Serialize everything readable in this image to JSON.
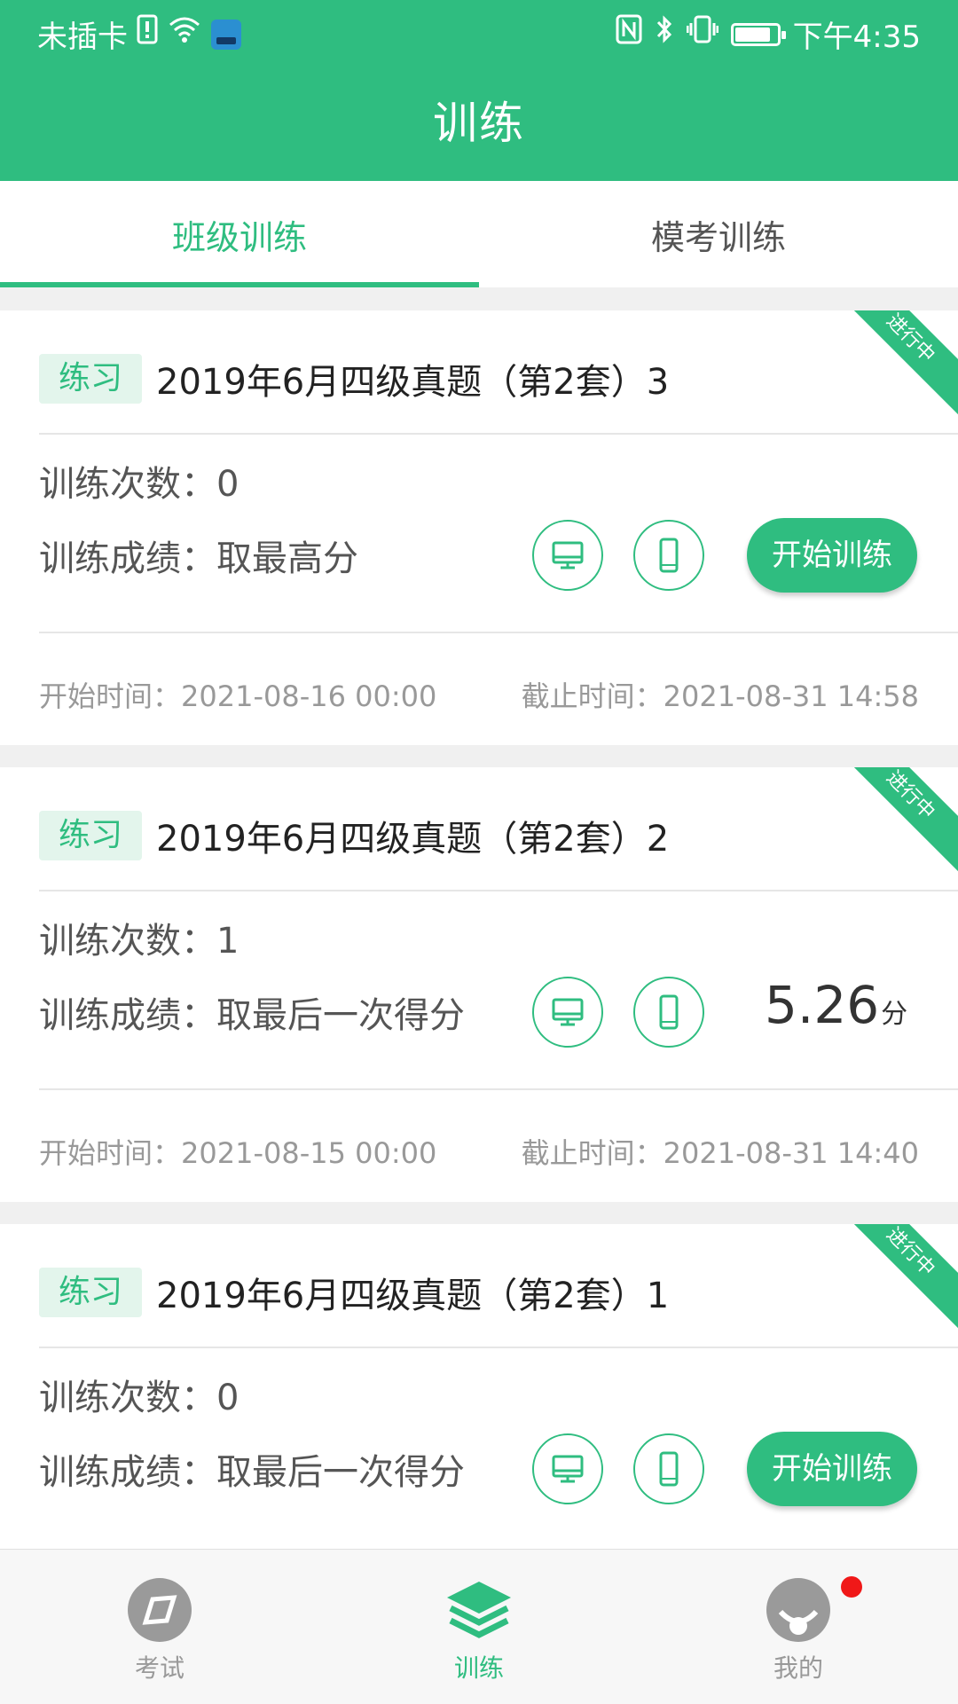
{
  "status_bar": {
    "carrier": "未插卡",
    "time": "下午4:35",
    "battery_level": 0.85
  },
  "header": {
    "title": "训练"
  },
  "tabs": [
    {
      "label": "班级训练",
      "active": true
    },
    {
      "label": "模考训练",
      "active": false
    }
  ],
  "cards": [
    {
      "badge": "进行中",
      "tag": "练习",
      "title": "2019年6月四级真题（第2套）3",
      "count_label": "训练次数：",
      "count": "0",
      "score_label": "训练成绩：",
      "score_rule": "取最高分",
      "action": "开始训练",
      "start_label": "开始时间：",
      "start_time": "2021-08-16 00:00",
      "end_label": "截止时间：",
      "end_time": "2021-08-31 14:58"
    },
    {
      "badge": "进行中",
      "tag": "练习",
      "title": "2019年6月四级真题（第2套）2",
      "count_label": "训练次数：",
      "count": "1",
      "score_label": "训练成绩：",
      "score_rule": "取最后一次得分",
      "score_value": "5.26",
      "score_unit": "分",
      "start_label": "开始时间：",
      "start_time": "2021-08-15 00:00",
      "end_label": "截止时间：",
      "end_time": "2021-08-31 14:40"
    },
    {
      "badge": "进行中",
      "tag": "练习",
      "title": "2019年6月四级真题（第2套）1",
      "count_label": "训练次数：",
      "count": "0",
      "score_label": "训练成绩：",
      "score_rule": "取最后一次得分",
      "action": "开始训练"
    }
  ],
  "bottom_nav": [
    {
      "label": "考试",
      "icon": "compass-icon",
      "active": false
    },
    {
      "label": "训练",
      "icon": "layers-icon",
      "active": true
    },
    {
      "label": "我的",
      "icon": "profile-icon",
      "active": false,
      "has_notification": true
    }
  ],
  "colors": {
    "primary": "#2fbd80",
    "tag_bg": "#e3f5ec",
    "notification": "#f01818"
  }
}
